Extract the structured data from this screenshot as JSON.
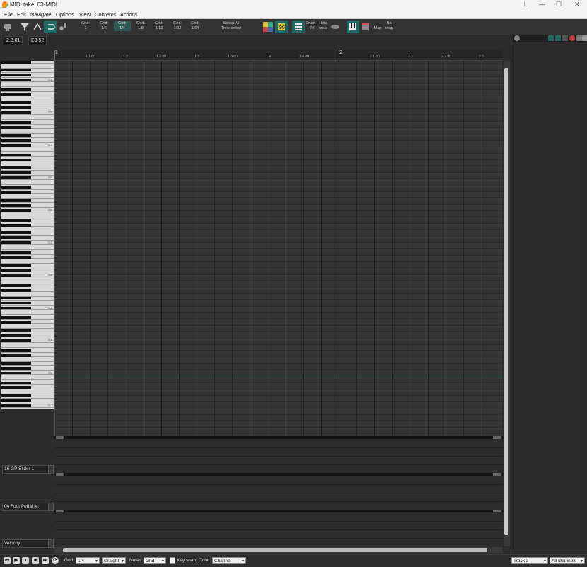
{
  "window": {
    "title": "MIDI take: 03-MIDI",
    "controls": {
      "pin": "⊥",
      "minimize": "—",
      "maximize": "☐",
      "close": "✕"
    }
  },
  "menu": [
    "File",
    "Edit",
    "Navigate",
    "Options",
    "View",
    "Contents",
    "Actions"
  ],
  "toolbar": {
    "grid_buttons": [
      {
        "line1": "Grid:",
        "line2": "1"
      },
      {
        "line1": "Grid:",
        "line2": "1/2"
      },
      {
        "line1": "Grid:",
        "line2": "1/4"
      },
      {
        "line1": "Grid:",
        "line2": "1/8"
      },
      {
        "line1": "Grid:",
        "line2": "1/16"
      },
      {
        "line1": "Grid:",
        "line2": "1/32"
      },
      {
        "line1": "Grid:",
        "line2": "1/64"
      }
    ],
    "active_grid_index": 2,
    "select_all_line1": "Select All",
    "select_all_line2": "Time select",
    "drum_line1": "Drum",
    "drum_line2": "+ Trl",
    "hide_line1": "Hide",
    "hide_line2": "unus",
    "map_label": "Map",
    "nosnap_line1": "No",
    "nosnap_line2": "snap",
    "accent_color": "#1f6b63"
  },
  "info": {
    "position": "2.3.01",
    "note": "E3  52"
  },
  "ruler": {
    "bar1": "1",
    "bar2": "2",
    "labels": [
      "1.1.80",
      "1.2",
      "1.2.80",
      "1.3",
      "1.3.80",
      "1.4",
      "1.4.80",
      "2.1.80",
      "2.2",
      "2.2.80",
      "2.3"
    ]
  },
  "piano": {
    "octave_labels": [
      "C9",
      "C8",
      "C7",
      "C6",
      "C5",
      "C4",
      "C3",
      "C2",
      "C1",
      "C0",
      "C-1"
    ]
  },
  "lanes": [
    {
      "label": "16 GP Slider 1"
    },
    {
      "label": "04 Foot Pedal M:"
    },
    {
      "label": "Velocity"
    }
  ],
  "bottom": {
    "grid_label": "Grid:",
    "grid_value": "1/4",
    "grid_type": "straight",
    "notes_label": "Notes:",
    "notes_value": "Grid",
    "key_snap_label": "Key snap",
    "key_snap_checked": false,
    "color_label": "Color:",
    "color_value": "Channel",
    "track_value": "Track 3",
    "channel_value": "All channels"
  }
}
